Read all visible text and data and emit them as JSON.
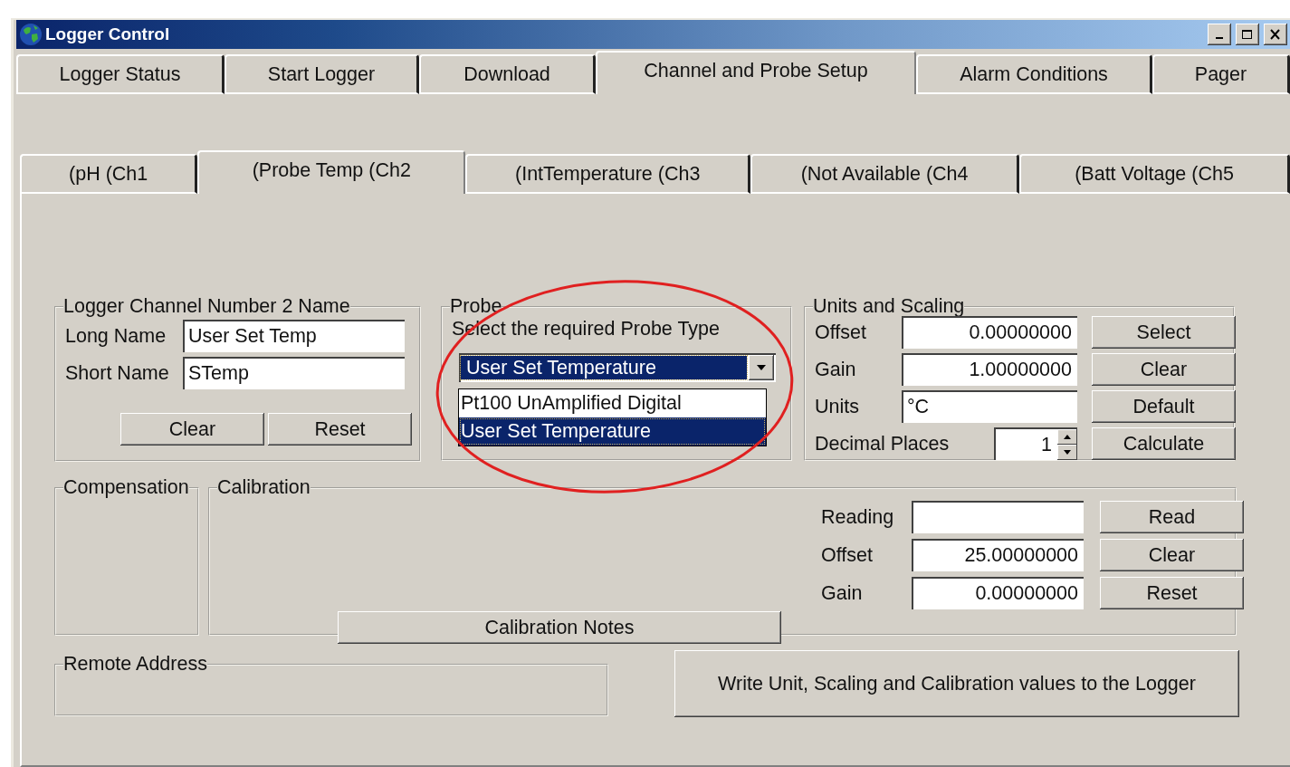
{
  "window": {
    "title": "Logger Control"
  },
  "tabs": [
    {
      "label": "Logger Status",
      "selected": false
    },
    {
      "label": "Start Logger",
      "selected": false
    },
    {
      "label": "Download",
      "selected": false
    },
    {
      "label": "Channel and Probe Setup",
      "selected": true
    },
    {
      "label": "Alarm Conditions",
      "selected": false
    },
    {
      "label": "Pager",
      "selected": false
    }
  ],
  "channel_tabs": [
    {
      "label": "(pH (Ch1",
      "selected": false
    },
    {
      "label": "(Probe Temp (Ch2",
      "selected": true
    },
    {
      "label": "(IntTemperature (Ch3",
      "selected": false
    },
    {
      "label": "(Not Available (Ch4",
      "selected": false
    },
    {
      "label": "(Batt Voltage (Ch5",
      "selected": false
    }
  ],
  "channel_name": {
    "title": "Logger Channel Number 2 Name",
    "fields": [
      {
        "label": "Long Name",
        "value": "User Set Temp"
      },
      {
        "label": "Short Name",
        "value": "STemp"
      }
    ],
    "buttons": [
      "Clear",
      "Reset"
    ]
  },
  "probe": {
    "title": "Probe",
    "prompt": "Select the required Probe Type",
    "value": "User Set Temperature",
    "expanded": true,
    "options": [
      {
        "label": "Pt100 UnAmplified Digital",
        "selected": false
      },
      {
        "label": "User Set Temperature",
        "selected": true
      }
    ]
  },
  "units_scaling": {
    "title": "Units and Scaling",
    "fields": [
      {
        "label": "Offset",
        "value": "0.00000000",
        "kind": "number"
      },
      {
        "label": "Gain",
        "value": "1.00000000",
        "kind": "number"
      },
      {
        "label": "Units",
        "value": "°C",
        "kind": "text"
      },
      {
        "label": "Decimal Places",
        "value": "1",
        "kind": "spinner"
      }
    ],
    "buttons": [
      "Select",
      "Clear",
      "Default",
      "Calculate"
    ]
  },
  "compensation": {
    "title": "Compensation"
  },
  "calibration": {
    "title": "Calibration",
    "fields": [
      {
        "label": "Reading",
        "kind": "number"
      },
      {
        "label": "Offset",
        "value": "25.00000000",
        "kind": "number"
      },
      {
        "label": "Gain",
        "value": "0.00000000",
        "kind": "number"
      }
    ],
    "buttons": [
      "Read",
      "Clear",
      "Reset"
    ],
    "notes_button": "Calibration Notes"
  },
  "remote_address": {
    "title": "Remote Address"
  },
  "write_button": "Write Unit, Scaling and Calibration values to the Logger"
}
